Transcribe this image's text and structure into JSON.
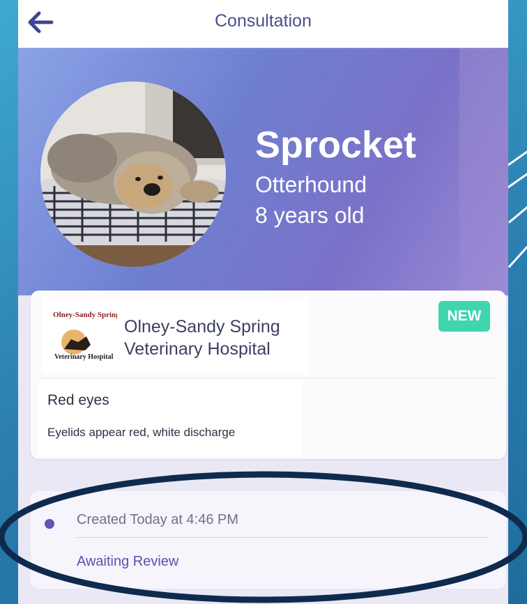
{
  "header": {
    "title": "Consultation",
    "back_icon": "arrow-left-icon"
  },
  "pet": {
    "name": "Sprocket",
    "breed": "Otterhound",
    "age": "8 years old"
  },
  "clinic": {
    "name": "Olney-Sandy Spring Veterinary Hospital",
    "logo_text_top": "Olney-Sandy Spring",
    "logo_text_bottom": "Veterinary Hospital",
    "badge": "NEW"
  },
  "consultation": {
    "complaint": "Red eyes",
    "details": "Eyelids appear red, white discharge"
  },
  "status": {
    "created": "Created Today at 4:46 PM",
    "state": "Awaiting Review"
  },
  "colors": {
    "accent": "#5b51b0",
    "badge": "#3fd6ae",
    "highlight": "#0f2a4d"
  }
}
